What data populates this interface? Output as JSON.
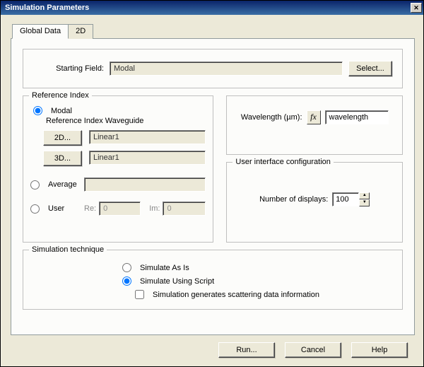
{
  "window": {
    "title": "Simulation Parameters"
  },
  "tabs": {
    "global": "Global Data",
    "two_d": "2D"
  },
  "starting_field": {
    "label": "Starting Field:",
    "value": "Modal",
    "select_btn": "Select..."
  },
  "reference_index": {
    "legend": "Reference Index",
    "modal": {
      "label": "Modal",
      "sublabel": "Reference Index Waveguide",
      "btn_2d": "2D...",
      "val_2d": "Linear1",
      "btn_3d": "3D...",
      "val_3d": "Linear1"
    },
    "average": {
      "label": "Average",
      "value": ""
    },
    "user": {
      "label": "User",
      "re_lbl": "Re:",
      "re_val": "0",
      "im_lbl": "Im:",
      "im_val": "0"
    }
  },
  "wavelength": {
    "label": "Wavelength (µm):",
    "fx": "fx",
    "value": "wavelength"
  },
  "uic": {
    "legend": "User interface configuration",
    "displays_lbl": "Number of displays:",
    "displays_val": "100"
  },
  "sim_tech": {
    "legend": "Simulation technique",
    "as_is": "Simulate As Is",
    "script": "Simulate Using Script",
    "scatter": "Simulation generates scattering data information"
  },
  "footer": {
    "run": "Run...",
    "cancel": "Cancel",
    "help": "Help"
  },
  "icons": {
    "close": "✕",
    "up": "▲",
    "down": "▼"
  }
}
